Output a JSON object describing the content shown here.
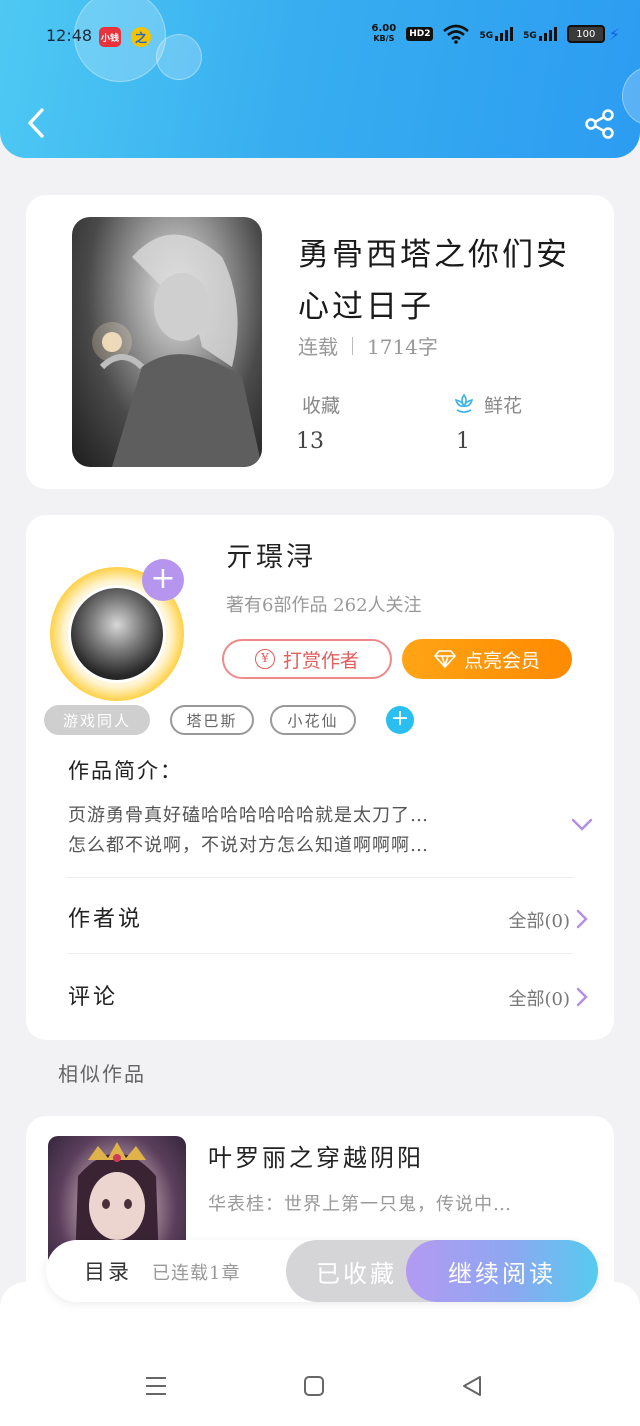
{
  "status_bar": {
    "time": "12:48",
    "badge1": "小钱",
    "badge2": "之",
    "net_speed_value": "6.00",
    "net_speed_unit": "KB/S",
    "hd": "HD2",
    "sig1": "5G",
    "sig2": "5G",
    "battery": "100"
  },
  "book": {
    "title": "勇骨西塔之你们安心过日子",
    "status": "连载",
    "word_count": "1714字",
    "favorites_label": "收藏",
    "favorites_value": "13",
    "flowers_label": "鲜花",
    "flowers_value": "1"
  },
  "author": {
    "name": "亓璟浔",
    "meta": "著有6部作品 262人关注",
    "reward_label": "打赏作者",
    "vip_label": "点亮会员",
    "tags": [
      "游戏同人",
      "塔巴斯",
      "小花仙"
    ]
  },
  "intro": {
    "label": "作品简介：",
    "line1": "页游勇骨真好磕哈哈哈哈哈哈就是太刀了…",
    "line2": "怎么都不说啊，不说对方怎么知道啊啊啊…"
  },
  "rows": {
    "author_says_label": "作者说",
    "author_says_count": "全部(0)",
    "comments_label": "评论",
    "comments_count": "全部(0)"
  },
  "similar": {
    "section_title": "相似作品",
    "items": [
      {
        "title": "叶罗丽之穿越阴阳",
        "desc": "华表桂：世界上第一只鬼，传说中…"
      }
    ]
  },
  "bottom_bar": {
    "toc_label": "目录",
    "toc_meta": "已连载1章",
    "favorited_label": "已收藏",
    "continue_label": "继续阅读"
  },
  "colors": {
    "header_blue": "#38aef0",
    "accent_purple": "#b695ee",
    "vip_orange": "#ff9a0a",
    "reward_red": "#e35d5d",
    "tag_blue": "#29bff0"
  },
  "icons": [
    "back-icon",
    "share-icon",
    "flower-icon",
    "plus-icon",
    "yen-icon",
    "diamond-icon",
    "chevron-down-icon",
    "chevron-right-icon",
    "menu-icon",
    "home-square-icon",
    "back-triangle-icon"
  ]
}
